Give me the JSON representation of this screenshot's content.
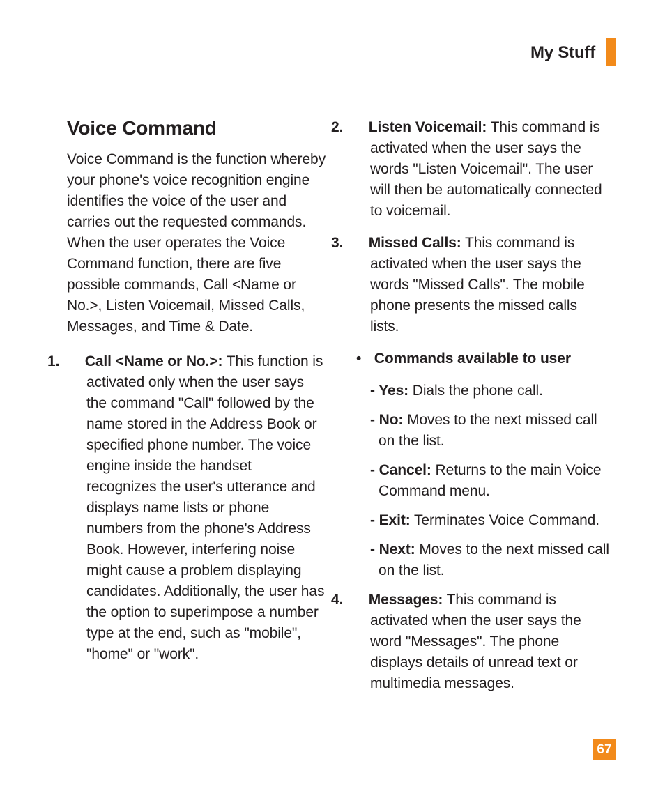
{
  "header": {
    "section": "My Stuff"
  },
  "heading": "Voice Command",
  "intro": "Voice Command is the function whereby your phone's voice recognition engine identifies the voice of the user and carries out the requested commands. When the user operates the Voice Command function, there are five possible commands, Call <Name or No.>, Listen Voicemail, Missed Calls, Messages, and Time & Date.",
  "items": {
    "one": {
      "num": "1.",
      "label": "Call <Name or No.>:",
      "body": " This function is activated only when the user says the command \"Call\" followed by the name stored in the Address Book or specified phone number. The voice engine inside the handset recognizes the user's utterance and displays name lists or phone numbers from the phone's Address Book. However, interfering noise might cause a problem displaying candidates. Additionally, the user has the option to superimpose a number type at the end, such as \"mobile\", \"home\" or \"work\"."
    },
    "two": {
      "num": "2.",
      "label": "Listen Voicemail:",
      "body": " This command is activated when the user says the words \"Listen Voicemail\". The user will then be automatically connected to voicemail."
    },
    "three": {
      "num": "3.",
      "label": "Missed Calls:",
      "body": " This command is activated when the user says the words \"Missed Calls\". The mobile phone presents the missed calls lists."
    },
    "bullet_heading": "Commands available to user",
    "sub": {
      "yes": {
        "label": "Yes:",
        "body": " Dials the phone call."
      },
      "no": {
        "label": "No:",
        "body": " Moves to the next missed call on the list."
      },
      "cancel": {
        "label": "Cancel:",
        "body": " Returns to the main Voice Command menu."
      },
      "exit": {
        "label": "Exit:",
        "body": " Terminates Voice Command."
      },
      "next": {
        "label": "Next:",
        "body": " Moves to the next missed call on the list."
      }
    },
    "four": {
      "num": "4.",
      "label": "Messages:",
      "body": " This command is activated when the user says the word \"Messages\". The phone displays details of unread text or multimedia messages."
    }
  },
  "page_number": "67"
}
